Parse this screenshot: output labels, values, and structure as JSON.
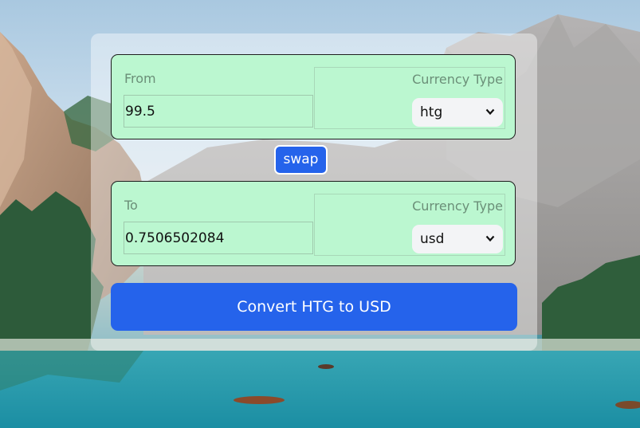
{
  "from": {
    "label": "From",
    "amount": "99.5",
    "currency_type_label": "Currency Type",
    "currency": "htg"
  },
  "swap_label": "swap",
  "to": {
    "label": "To",
    "amount": "0.7506502084",
    "currency_type_label": "Currency Type",
    "currency": "usd"
  },
  "convert_label": "Convert HTG to USD",
  "colors": {
    "box_background": "#bbf7d0",
    "button_blue": "#2563eb",
    "select_background": "#f3f4f6"
  },
  "icons": {
    "select_arrow": "chevron-down-icon"
  }
}
